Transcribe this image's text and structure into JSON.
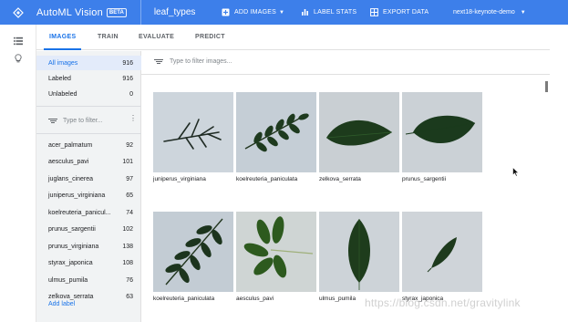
{
  "topbar": {
    "product": "AutoML Vision",
    "beta": "BETA",
    "dataset": "leaf_types",
    "add_images": "ADD IMAGES",
    "label_stats": "LABEL STATS",
    "export_data": "EXPORT DATA",
    "project": "next18-keynote-demo",
    "colors": {
      "bar": "#3d7fea"
    }
  },
  "tabs": [
    {
      "label": "IMAGES",
      "active": true
    },
    {
      "label": "TRAIN",
      "active": false
    },
    {
      "label": "EVALUATE",
      "active": false
    },
    {
      "label": "PREDICT",
      "active": false
    }
  ],
  "summary": [
    {
      "label": "All images",
      "count": "916"
    },
    {
      "label": "Labeled",
      "count": "916"
    },
    {
      "label": "Unlabeled",
      "count": "0"
    }
  ],
  "label_filter_placeholder": "Type to filter...",
  "labels": [
    {
      "label": "acer_palmatum",
      "count": "92"
    },
    {
      "label": "aesculus_pavi",
      "count": "101"
    },
    {
      "label": "juglans_cinerea",
      "count": "97"
    },
    {
      "label": "juniperus_virginiana",
      "count": "65"
    },
    {
      "label": "koelreuteria_panicul...",
      "count": "74"
    },
    {
      "label": "prunus_sargentii",
      "count": "102"
    },
    {
      "label": "prunus_virginiana",
      "count": "138"
    },
    {
      "label": "styrax_japonica",
      "count": "108"
    },
    {
      "label": "ulmus_pumila",
      "count": "76"
    },
    {
      "label": "zelkova_serrata",
      "count": "63"
    }
  ],
  "add_label": "Add label",
  "image_filter_placeholder": "Type to filter images...",
  "images": [
    {
      "caption": "juniperus_virginiana"
    },
    {
      "caption": "koelreuteria_paniculata"
    },
    {
      "caption": "zelkova_serrata"
    },
    {
      "caption": "prunus_sargentii"
    },
    {
      "caption": "koelreuteria_paniculata"
    },
    {
      "caption": "aesculus_pavi"
    },
    {
      "caption": "ulmus_pumila"
    },
    {
      "caption": "styrax_japonica"
    }
  ],
  "watermark": "https://blog.csdn.net/gravitylink"
}
